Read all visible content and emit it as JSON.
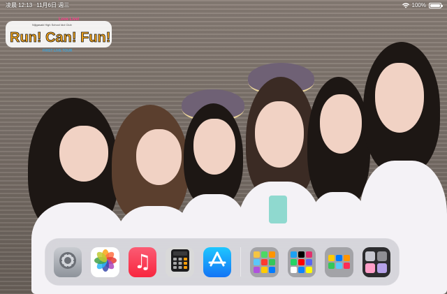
{
  "status_bar": {
    "time": "凌晨 12:13",
    "date": "11月6日 週三",
    "battery_text": "100%",
    "battery_level": 1.0,
    "icons": [
      "wifi-icon",
      "battery-icon"
    ]
  },
  "wallpaper": {
    "logo": {
      "small_text": "Love Live!",
      "subtitle": "Nijigasaki High School Idol Club",
      "title": "Run! Can! Fun!",
      "tour_text": "FIRST LIVE TOUR"
    }
  },
  "dock": {
    "apps": [
      {
        "name": "Settings",
        "icon": "gear-icon",
        "color": "#9aa0a8"
      },
      {
        "name": "Photos",
        "icon": "flower-icon",
        "color": "#ffffff"
      },
      {
        "name": "Music",
        "icon": "music-note-icon",
        "glyph": "♫",
        "color": "#fa3c55"
      },
      {
        "name": "Calculator",
        "icon": "calculator-icon",
        "color": "#d9d9d9"
      },
      {
        "name": "App Store",
        "icon": "app-store-icon",
        "color": "#1a8cf8"
      }
    ],
    "folders": [
      {
        "icon": "folder-icon",
        "tiles": [
          "#f5c542",
          "#4cd964",
          "#ff9500",
          "#5ac8fa",
          "#ff3b30",
          "#34c759",
          "#af52de",
          "#ffcc00",
          "#007aff"
        ]
      },
      {
        "icon": "folder-icon",
        "tiles": [
          "#1da1f2",
          "#000000",
          "#e1306c",
          "#25d366",
          "#ff0000",
          "#5865f2",
          "#ffffff",
          "#0a84ff",
          "#fffc00"
        ]
      },
      {
        "icon": "folder-icon",
        "tiles": [
          "#ffcc00",
          "#007aff",
          "#ff9500",
          "#34c759",
          "#5ac8fa",
          "#ff2d55"
        ]
      },
      {
        "icon": "folder-icon",
        "tiles": [
          "#c8c8d0",
          "#8e8e93",
          "#ff9ec7",
          "#b5a1e8"
        ]
      }
    ]
  },
  "colors": {
    "dock_background": "#bebec4",
    "status_text": "#ffffff"
  }
}
